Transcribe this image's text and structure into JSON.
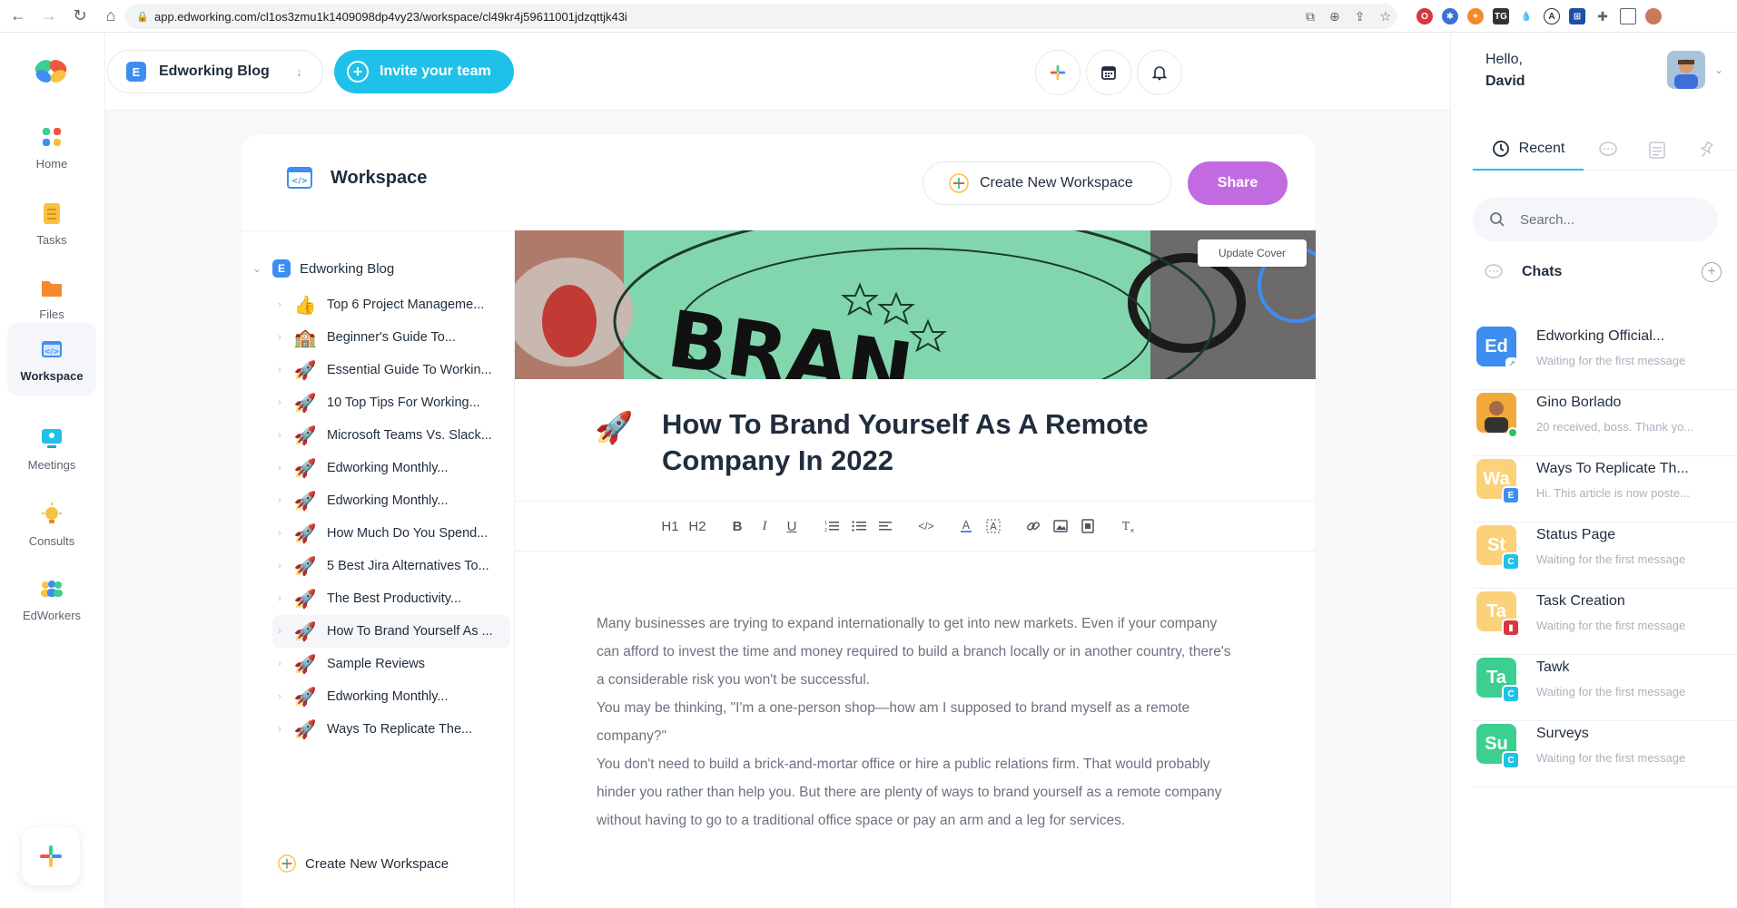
{
  "browser": {
    "url": "app.edworking.com/cl1os3zmu1k1409098dp4vy23/workspace/cl49kr4j59611001jdzqttjk43i"
  },
  "sidebar": {
    "items": [
      {
        "label": "Home",
        "icon": "home-icon"
      },
      {
        "label": "Tasks",
        "icon": "tasks-icon"
      },
      {
        "label": "Files",
        "icon": "folder-icon"
      },
      {
        "label": "Workspace",
        "icon": "workspace-icon"
      },
      {
        "label": "Meetings",
        "icon": "meetings-icon"
      },
      {
        "label": "Consults",
        "icon": "lightbulb-icon"
      },
      {
        "label": "EdWorkers",
        "icon": "people-icon"
      }
    ]
  },
  "header": {
    "workspace_badge": "E",
    "workspace_name": "Edworking Blog",
    "invite_label": "Invite your team"
  },
  "workspace": {
    "title": "Workspace",
    "create_label": "Create New Workspace",
    "share_label": "Share"
  },
  "tree": {
    "root_badge": "E",
    "root_label": "Edworking Blog",
    "items": [
      {
        "label": "Top 6 Project Manageme...",
        "emoji": "👍"
      },
      {
        "label": "Beginner's Guide To...",
        "emoji": "🏫"
      },
      {
        "label": "Essential Guide To Workin...",
        "emoji": "🚀"
      },
      {
        "label": "10 Top Tips For Working...",
        "emoji": "🚀"
      },
      {
        "label": "Microsoft Teams Vs. Slack...",
        "emoji": "🚀"
      },
      {
        "label": "Edworking Monthly...",
        "emoji": "🚀"
      },
      {
        "label": "Edworking Monthly...",
        "emoji": "🚀"
      },
      {
        "label": "How Much Do You Spend...",
        "emoji": "🚀"
      },
      {
        "label": "5 Best Jira Alternatives To...",
        "emoji": "🚀"
      },
      {
        "label": "The Best Productivity...",
        "emoji": "🚀"
      },
      {
        "label": "How To Brand Yourself As ...",
        "emoji": "🚀"
      },
      {
        "label": "Sample Reviews",
        "emoji": "🚀"
      },
      {
        "label": "Edworking Monthly...",
        "emoji": "🚀"
      },
      {
        "label": "Ways To Replicate The...",
        "emoji": "🚀"
      }
    ],
    "active_index": 10,
    "create_label": "Create New Workspace"
  },
  "article": {
    "update_cover_label": "Update Cover",
    "cover_text": "BRAN",
    "emoji": "🚀",
    "title": "How To Brand Yourself As A Remote Company In 2022",
    "toolbar": {
      "h1": "H1",
      "h2": "H2",
      "bold": "B",
      "italic": "I",
      "underline": "U"
    },
    "paragraphs": [
      "Many businesses are trying to expand internationally to get into new markets. Even if your company can afford to invest the time and money required to build a branch locally or in another country, there's a considerable risk you won't be successful.",
      "You may be thinking, \"I'm a one-person shop—how am I supposed to brand myself as a remote company?\"",
      "You don't need to build a brick-and-mortar office or hire a public relations firm. That would probably hinder you rather than help you. But there are plenty of ways to brand yourself as a remote company without having to go to a traditional office space or pay an arm and a leg for services."
    ]
  },
  "right_panel": {
    "greeting": "Hello,",
    "user_name": "David",
    "recent_tab_label": "Recent",
    "search_placeholder": "Search...",
    "chats_label": "Chats",
    "chats": [
      {
        "initials": "Ed",
        "name": "Edworking Official...",
        "message": "Waiting for the first message",
        "color": "#3d8ef0",
        "badge": "",
        "badge_color": "#ffffff"
      },
      {
        "initials": "",
        "name": "Gino Borlado",
        "message": "20 received, boss. Thank yo...",
        "color": "#f2a93b",
        "badge": "",
        "badge_color": "#22c55e"
      },
      {
        "initials": "Wa",
        "name": "Ways To Replicate Th...",
        "message": "Hi. This article is now poste...",
        "color": "#fbd27a",
        "badge": "E",
        "badge_color": "#3d8ef0"
      },
      {
        "initials": "St",
        "name": "Status Page",
        "message": "Waiting for the first message",
        "color": "#fbd27a",
        "badge": "C",
        "badge_color": "#1fc1e8"
      },
      {
        "initials": "Ta",
        "name": "Task Creation",
        "message": "Waiting for the first message",
        "color": "#fbd27a",
        "badge": "▮",
        "badge_color": "#d9363e"
      },
      {
        "initials": "Ta",
        "name": "Tawk",
        "message": "Waiting for the first message",
        "color": "#3ccf91",
        "badge": "C",
        "badge_color": "#1fc1e8"
      },
      {
        "initials": "Su",
        "name": "Surveys",
        "message": "Waiting for the first message",
        "color": "#3ccf91",
        "badge": "C",
        "badge_color": "#1fc1e8"
      }
    ]
  },
  "colors": {
    "accent": "#1fc1e8",
    "share": "#c26be0"
  }
}
